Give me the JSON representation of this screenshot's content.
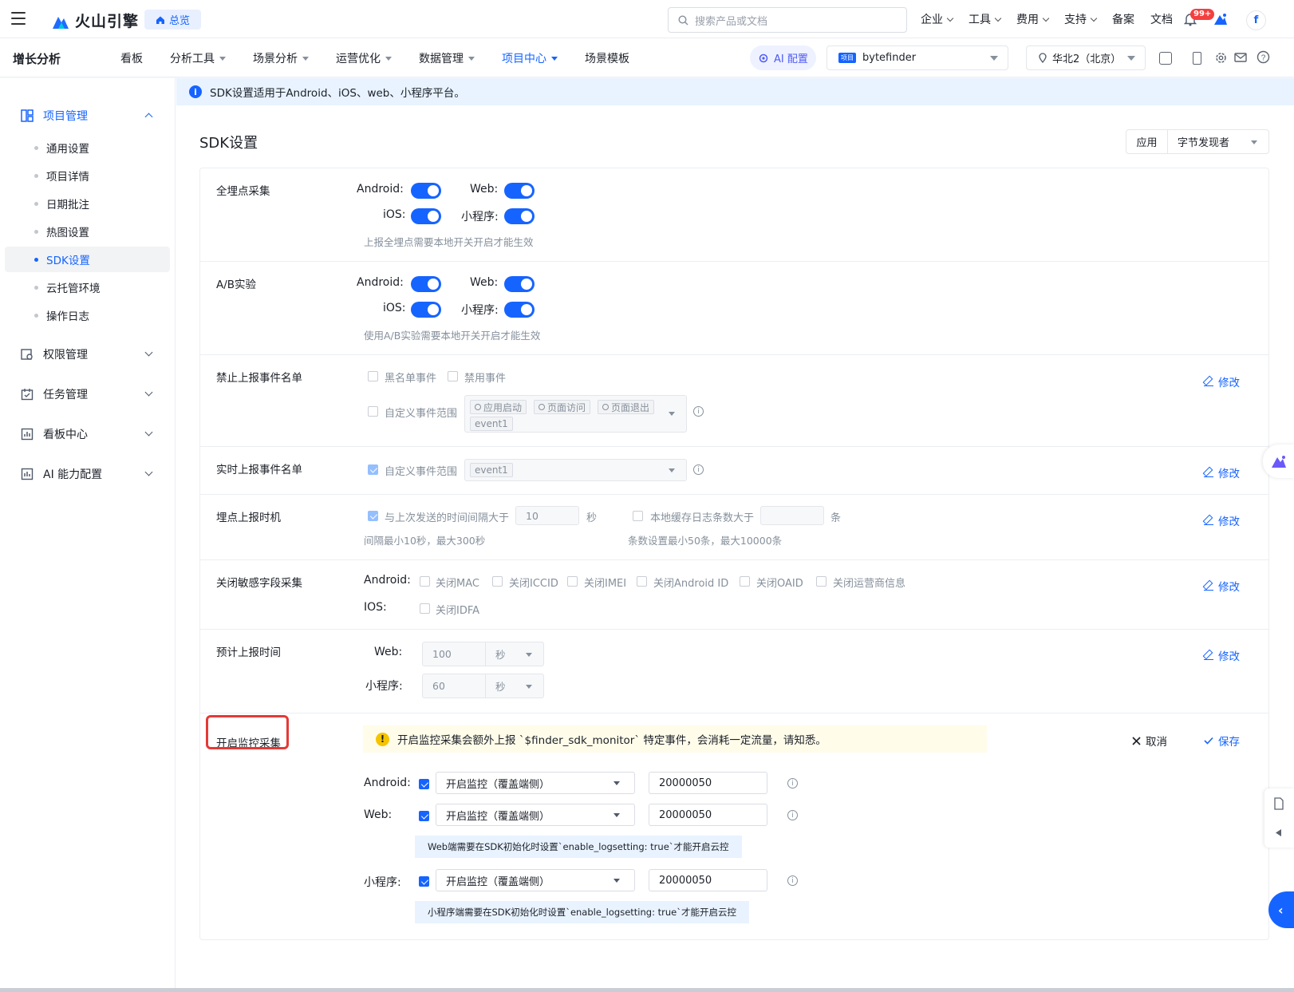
{
  "topbar": {
    "logo_text": "火山引擎",
    "home_label": "总览",
    "search_placeholder": "搜索产品或文档",
    "nav": [
      {
        "label": "企业",
        "dropdown": true
      },
      {
        "label": "工具",
        "dropdown": true
      },
      {
        "label": "费用",
        "dropdown": true
      },
      {
        "label": "支持",
        "dropdown": true
      },
      {
        "label": "备案",
        "dropdown": false
      },
      {
        "label": "文档",
        "dropdown": false
      }
    ],
    "notification_badge": "99+",
    "avatar_letter": "f"
  },
  "subbar": {
    "app_name": "增长分析",
    "nav": [
      {
        "label": "看板"
      },
      {
        "label": "分析工具"
      },
      {
        "label": "场景分析"
      },
      {
        "label": "运营优化"
      },
      {
        "label": "数据管理"
      },
      {
        "label": "项目中心"
      },
      {
        "label": "场景模板"
      }
    ],
    "active_nav": "项目中心",
    "ai_label": "AI 配置",
    "project_tag": "项目",
    "project_name": "bytefinder",
    "region": "华北2（北京）"
  },
  "sidebar": {
    "project_mgmt": "项目管理",
    "sub_items": [
      "通用设置",
      "项目详情",
      "日期批注",
      "热图设置",
      "SDK设置",
      "云托管环境",
      "操作日志"
    ],
    "active_sub": "SDK设置",
    "groups": [
      "权限管理",
      "任务管理",
      "看板中心",
      "AI 能力配置"
    ]
  },
  "banner": {
    "text": "SDK设置适用于Android、iOS、web、小程序平台。"
  },
  "page": {
    "title": "SDK设置",
    "app_label": "应用",
    "app_value": "字节发现者"
  },
  "common": {
    "modify": "修改",
    "android_label": "Android:",
    "web_label": "Web:",
    "ios_label": "iOS:",
    "mp_label": "小程序:"
  },
  "rows": {
    "full_tracking": {
      "label": "全埋点采集",
      "hint": "上报全埋点需要本地开关开启才能生效",
      "android": true,
      "web": true,
      "ios": true,
      "mini_program": true
    },
    "ab_test": {
      "label": "A/B实验",
      "hint": "使用A/B实验需要本地开关开启才能生效",
      "android": true,
      "web": true,
      "ios": true,
      "mini_program": true
    },
    "block_list": {
      "label": "禁止上报事件名单",
      "blacklist": "黑名单事件",
      "disabled_events": "禁用事件",
      "custom_range": "自定义事件范围",
      "tags": [
        "应用启动",
        "页面访问",
        "页面退出",
        "event1"
      ]
    },
    "realtime": {
      "label": "实时上报事件名单",
      "custom_range": "自定义事件范围",
      "tag": "event1"
    },
    "timing": {
      "label": "埋点上报时机",
      "interval_label": "与上次发送的时间间隔大于",
      "interval_value": "10",
      "interval_unit": "秒",
      "interval_hint": "间隔最小10秒，最大300秒",
      "cache_label": "本地缓存日志条数大于",
      "cache_unit": "条",
      "cache_hint": "条数设置最小50条，最大10000条"
    },
    "sensitive": {
      "label": "关闭敏感字段采集",
      "android_label": "Android:",
      "ios_label": "IOS:",
      "android_options": [
        "关闭MAC",
        "关闭ICCID",
        "关闭IMEI",
        "关闭Android ID",
        "关闭OAID",
        "关闭运营商信息"
      ],
      "ios_options": [
        "关闭IDFA"
      ]
    },
    "report_time": {
      "label": "预计上报时间",
      "web_value": "100",
      "mp_value": "60",
      "unit": "秒"
    },
    "monitor": {
      "label": "开启监控采集",
      "warning": "开启监控采集会额外上报 `$finder_sdk_monitor` 特定事件，会消耗一定流量，请知悉。",
      "cancel": "取消",
      "save": "保存",
      "mode": "开启监控（覆盖端侧）",
      "android_value": "20000050",
      "web_value": "20000050",
      "mp_value": "20000050",
      "web_note": "Web端需要在SDK初始化时设置`enable_logsetting: true`才能开启云控",
      "mp_note": "小程序端需要在SDK初始化时设置`enable_logsetting: true`才能开启云控"
    }
  },
  "colors": {
    "primary": "#1664ff",
    "highlight_box": "#e53935",
    "warning_bg": "#fffcea",
    "info_bg": "#e8f3ff"
  }
}
